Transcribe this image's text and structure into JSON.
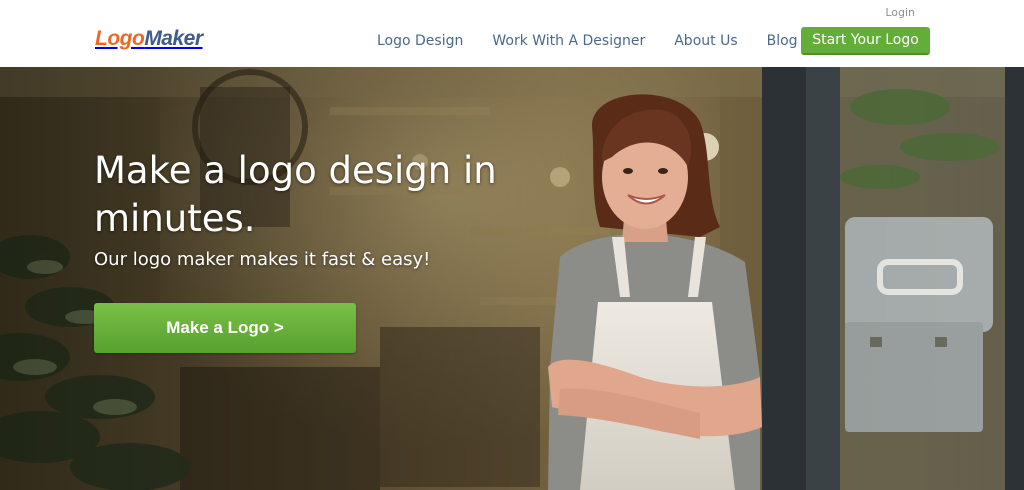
{
  "header": {
    "login_label": "Login",
    "logo": {
      "part_a": "Logo",
      "part_b": "Maker"
    },
    "nav": [
      {
        "label": "Logo Design"
      },
      {
        "label": "Work With A Designer"
      },
      {
        "label": "About Us"
      },
      {
        "label": "Blog"
      }
    ],
    "cta_label": "Start Your Logo"
  },
  "hero": {
    "title": "Make a logo design in minutes.",
    "subtitle": "Our logo maker makes it fast & easy!",
    "button_label": "Make a Logo >",
    "image_description_icon": "photo-woman-in-apron"
  },
  "colors": {
    "brand_orange": "#ea6a24",
    "brand_blue": "#3d5c8a",
    "nav_text": "#4a6a8a",
    "accent_green": "#63ad39"
  }
}
